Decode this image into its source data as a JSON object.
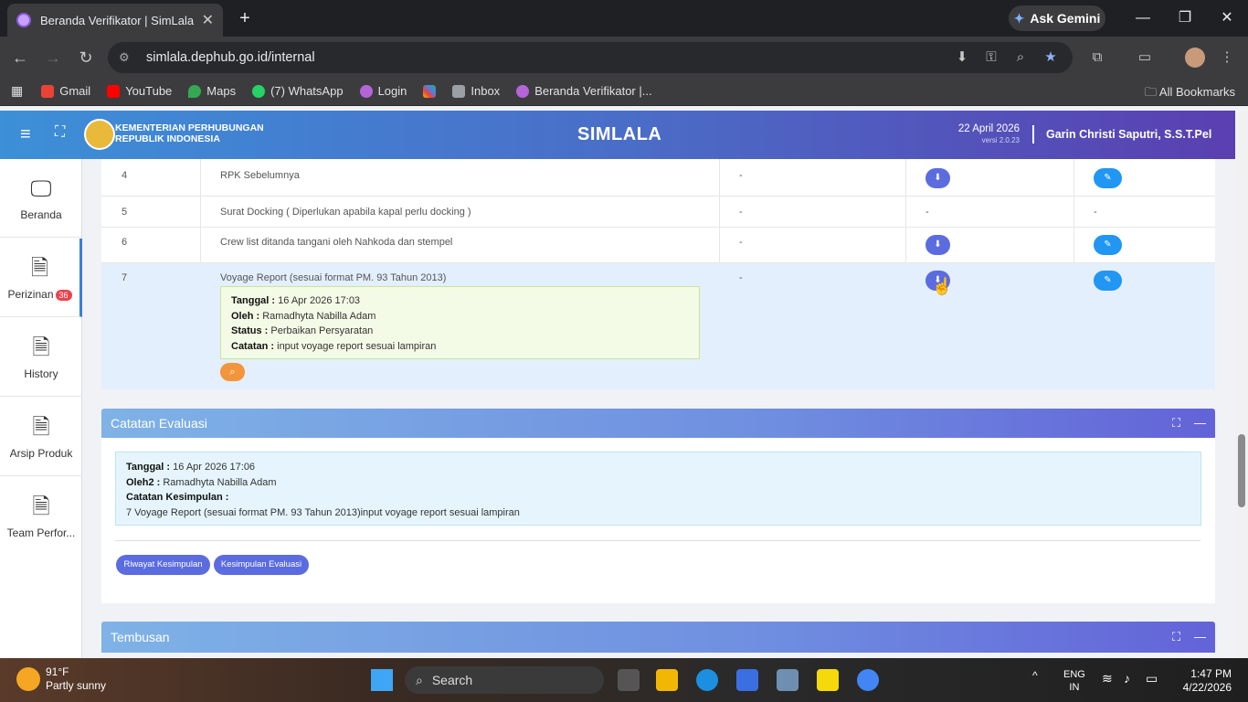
{
  "browser": {
    "tab_title": "Beranda Verifikator | SimLala",
    "tab_close": "✕",
    "new_tab": "+",
    "gemini": "Ask Gemini",
    "url": "simlala.dephub.go.id/internal",
    "bookmarks": [
      "Gmail",
      "YouTube",
      "Maps",
      "(7) WhatsApp",
      "Login",
      "",
      "Inbox",
      "Beranda Verifikator |..."
    ],
    "all_bookmarks": "All Bookmarks"
  },
  "app": {
    "ministry_line1": "KEMENTERIAN PERHUBUNGAN",
    "ministry_line2": "REPUBLIK INDONESIA",
    "title": "SIMLALA",
    "date": "22 April 2026",
    "version": "versi 2.0.23",
    "user": "Garin Christi Saputri, S.S.T.Pel"
  },
  "sidebar": {
    "items": [
      {
        "label": "Beranda"
      },
      {
        "label": "Perizinan",
        "badge": "36"
      },
      {
        "label": "History"
      },
      {
        "label": "Arsip Produk"
      },
      {
        "label": "Team Perfor..."
      }
    ]
  },
  "table": {
    "rows": [
      {
        "no": "4",
        "doc": "RPK Sebelumnya",
        "c3": "-",
        "download": true,
        "edit": true
      },
      {
        "no": "5",
        "doc": "Surat Docking ( Diperlukan apabila kapal perlu docking )",
        "c3": "-",
        "c4": "-",
        "c5": "-"
      },
      {
        "no": "6",
        "doc": "Crew list ditanda tangani oleh Nahkoda dan stempel",
        "c3": "-",
        "download": true,
        "edit": true
      },
      {
        "no": "7",
        "doc": "Voyage Report (sesuai format PM. 93 Tahun 2013)",
        "c3": "-",
        "download": true,
        "edit": true
      }
    ],
    "info": {
      "tanggal_label": "Tanggal :",
      "tanggal": "16 Apr 2026 17:03",
      "oleh_label": "Oleh :",
      "oleh": "Ramadhyta Nabilla Adam",
      "status_label": "Status :",
      "status": "Perbaikan Persyaratan",
      "catatan_label": "Catatan :",
      "catatan": "input voyage report sesuai lampiran"
    }
  },
  "evaluasi": {
    "header": "Catatan Evaluasi",
    "tanggal_label": "Tanggal :",
    "tanggal": "16 Apr 2026 17:06",
    "oleh_label": "Oleh2 :",
    "oleh": "Ramadhyta Nabilla Adam",
    "kesimpulan_label": "Catatan Kesimpulan :",
    "kesimpulan": "7 Voyage Report (sesuai format PM. 93 Tahun 2013)input voyage report sesuai lampiran",
    "btn_riwayat": "Riwayat Kesimpulan",
    "btn_kesimpulan": "Kesimpulan Evaluasi"
  },
  "tembusan": {
    "header": "Tembusan"
  },
  "taskbar": {
    "temp": "91°F",
    "weather": "Partly sunny",
    "search": "Search",
    "lang1": "ENG",
    "lang2": "IN",
    "time": "1:47 PM",
    "date": "4/22/2026"
  }
}
